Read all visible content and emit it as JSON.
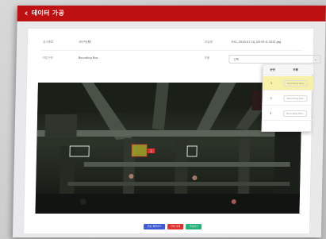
{
  "titlebar": {
    "back": "‹",
    "title": "데이터 가공"
  },
  "info": {
    "row1": [
      {
        "label": "검사종류",
        "value": "사이저(통)"
      },
      {
        "label": "파일명",
        "value": "EXL_2019-07-16_08-55-4-2031.jpg"
      }
    ],
    "row2": [
      {
        "label": "작업구분",
        "value": "Bounding Box"
      },
      {
        "label": "부품",
        "value": "선택"
      }
    ]
  },
  "legend": {
    "headers": [
      "순번",
      "부품"
    ],
    "rows": [
      {
        "num": "1",
        "part": "Bounding Box"
      },
      {
        "num": "2",
        "part": "Bounding Box"
      },
      {
        "num": "3",
        "part": "Bounding Box"
      }
    ]
  },
  "annotation": {
    "tag": "1"
  },
  "buttons": [
    {
      "label": "원본 복원하기",
      "color": "#3e5ad8"
    },
    {
      "label": "전체 삭제",
      "color": "#e03030"
    },
    {
      "label": "저장하기",
      "color": "#27b27a"
    }
  ]
}
